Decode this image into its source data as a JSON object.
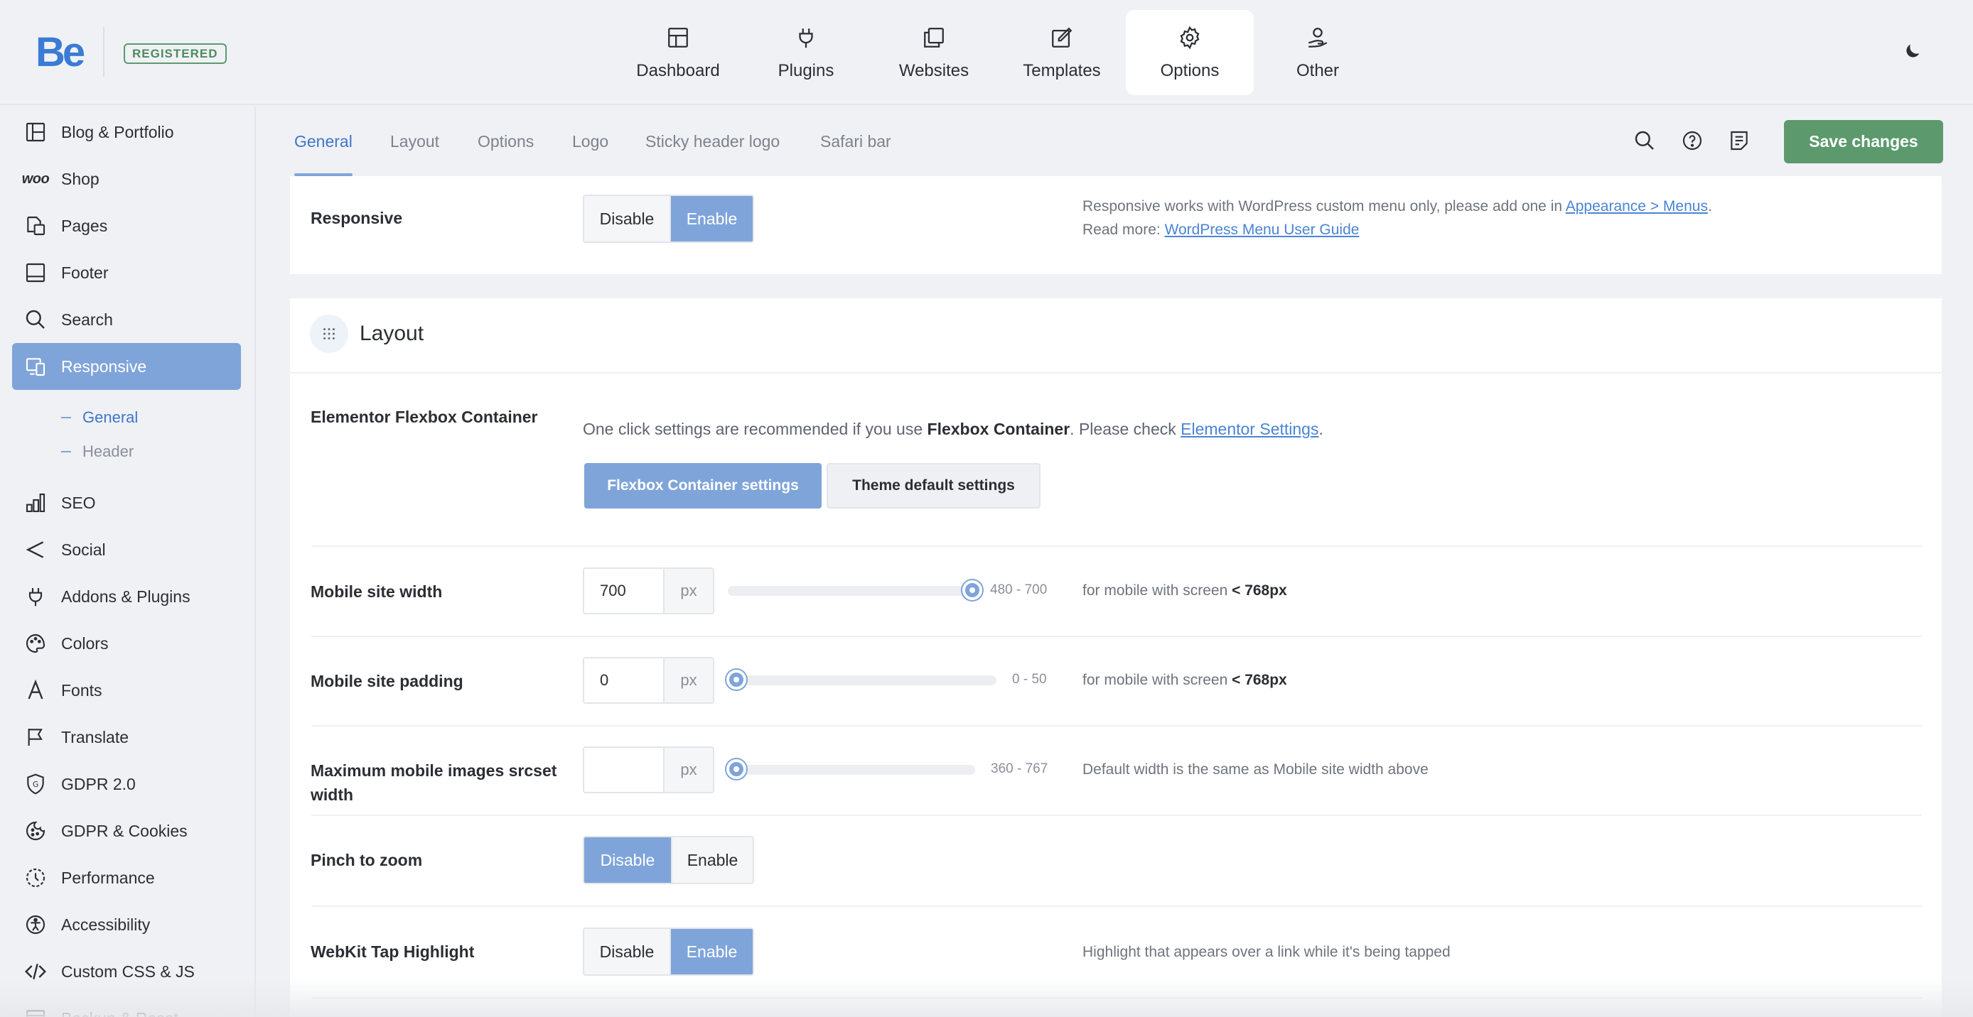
{
  "brand": {
    "logo": "Be",
    "badge": "REGISTERED",
    "accent": "#7fa4d9",
    "save_color": "#5c9a6e"
  },
  "topnav": [
    {
      "label": "Dashboard",
      "icon": "dashboard-icon"
    },
    {
      "label": "Plugins",
      "icon": "plug-icon"
    },
    {
      "label": "Websites",
      "icon": "websites-icon"
    },
    {
      "label": "Templates",
      "icon": "templates-icon"
    },
    {
      "label": "Options",
      "icon": "gear-icon",
      "active": true
    },
    {
      "label": "Other",
      "icon": "user-hand-icon"
    }
  ],
  "sidebar": {
    "items": [
      {
        "label": "Blog & Portfolio",
        "icon": "blog-icon"
      },
      {
        "label": "Shop",
        "icon": "woo-icon",
        "icon_text": "woo"
      },
      {
        "label": "Pages",
        "icon": "pages-icon"
      },
      {
        "label": "Footer",
        "icon": "footer-icon"
      },
      {
        "label": "Search",
        "icon": "search-icon"
      },
      {
        "label": "Responsive",
        "icon": "responsive-icon",
        "active": true
      },
      {
        "label": "SEO",
        "icon": "seo-icon"
      },
      {
        "label": "Social",
        "icon": "share-icon"
      },
      {
        "label": "Addons & Plugins",
        "icon": "plug-icon"
      },
      {
        "label": "Colors",
        "icon": "palette-icon"
      },
      {
        "label": "Fonts",
        "icon": "fonts-icon"
      },
      {
        "label": "Translate",
        "icon": "flag-icon"
      },
      {
        "label": "GDPR 2.0",
        "icon": "shield-icon"
      },
      {
        "label": "GDPR & Cookies",
        "icon": "cookie-icon"
      },
      {
        "label": "Performance",
        "icon": "performance-icon"
      },
      {
        "label": "Accessibility",
        "icon": "accessibility-icon"
      },
      {
        "label": "Custom CSS & JS",
        "icon": "code-icon"
      },
      {
        "label": "Backup & Reset",
        "icon": "backup-icon"
      }
    ],
    "sub_items": [
      {
        "label": "General",
        "active": true
      },
      {
        "label": "Header"
      }
    ]
  },
  "subtabs": [
    {
      "label": "General",
      "active": true
    },
    {
      "label": "Layout"
    },
    {
      "label": "Options"
    },
    {
      "label": "Logo"
    },
    {
      "label": "Sticky header logo"
    },
    {
      "label": "Safari bar"
    }
  ],
  "toolbar": {
    "save_label": "Save changes"
  },
  "responsive_row": {
    "label": "Responsive",
    "options": [
      "Disable",
      "Enable"
    ],
    "selected": "Enable",
    "desc_pre": "Responsive works with WordPress custom menu only, please add one in ",
    "desc_link": "Appearance > Menus",
    "desc_post": ".",
    "read_more_pre": "Read more: ",
    "read_more_link": "WordPress Menu User Guide"
  },
  "layout_section": {
    "title": "Layout",
    "elementor": {
      "label": "Elementor Flexbox Container",
      "desc_pre": "One click settings are recommended if you use ",
      "desc_bold": "Flexbox Container",
      "desc_mid": ". Please check ",
      "desc_link": "Elementor Settings",
      "desc_post": ".",
      "btn_primary": "Flexbox Container settings",
      "btn_secondary": "Theme default settings"
    },
    "mobile_width": {
      "label": "Mobile site width",
      "value": "700",
      "unit": "px",
      "range": "480 - 700",
      "min": 480,
      "max": 700,
      "desc_pre": "for mobile with screen ",
      "desc_bold": "< 768px"
    },
    "mobile_padding": {
      "label": "Mobile site padding",
      "value": "0",
      "unit": "px",
      "range": "0 - 50",
      "min": 0,
      "max": 50,
      "desc_pre": "for mobile with screen ",
      "desc_bold": "< 768px"
    },
    "srcset": {
      "label": "Maximum mobile images srcset width",
      "value": "",
      "unit": "px",
      "range": "360 - 767",
      "min": 360,
      "max": 767,
      "desc": "Default width is the same as Mobile site width above"
    },
    "pinch": {
      "label": "Pinch to zoom",
      "options": [
        "Disable",
        "Enable"
      ],
      "selected": "Disable"
    },
    "webkit": {
      "label": "WebKit Tap Highlight",
      "options": [
        "Disable",
        "Enable"
      ],
      "selected": "Enable",
      "desc": "Highlight that appears over a link while it's being tapped"
    }
  }
}
